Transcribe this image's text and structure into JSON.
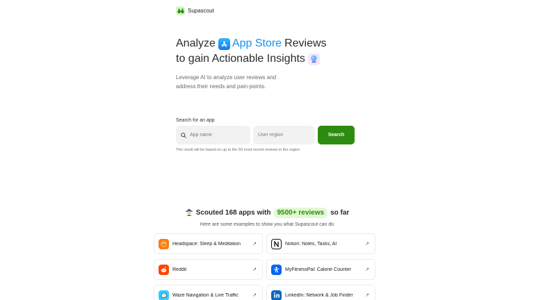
{
  "brand": {
    "name": "Supascout",
    "icon": "binoculars-icon"
  },
  "hero": {
    "word_analyze": "Analyze",
    "word_store": "App Store",
    "word_reviews": "Reviews",
    "line2": "to gain Actionable Insights",
    "subtitle": "Leverage AI to analyze user reviews and address their needs and pain-points."
  },
  "search": {
    "label": "Search for an app",
    "app_placeholder": "App name",
    "region_placeholder": "User region",
    "button_label": "Search",
    "note": "The result will be based on up to the 50 most recent reviews in the region"
  },
  "stats": {
    "text_prefix": "Scouted 168 apps with",
    "highlight": "9500+ reviews",
    "text_suffix": "so far",
    "subtitle": "Here are some examples to show you what Supascout can do"
  },
  "apps": [
    {
      "name": "Headspace: Sleep & Meditation",
      "icon": "headspace-icon",
      "color": "#ff7a1a"
    },
    {
      "name": "Notion: Notes, Tasks, AI",
      "icon": "notion-icon",
      "color": "#111111"
    },
    {
      "name": "Reddit",
      "icon": "reddit-icon",
      "color": "#ff4500"
    },
    {
      "name": "MyFitnessPal: Calorie Counter",
      "icon": "myfitnesspal-icon",
      "color": "#0066ee"
    },
    {
      "name": "Waze Navigation & Live Traffic",
      "icon": "waze-icon",
      "color": "#33ccff"
    },
    {
      "name": "LinkedIn: Network & Job Finder",
      "icon": "linkedin-icon",
      "color": "#0a66c2"
    }
  ],
  "colors": {
    "accent_blue": "#1a8fe6",
    "primary_green": "#2e8b12",
    "highlight_bg": "#e3f8d4"
  }
}
